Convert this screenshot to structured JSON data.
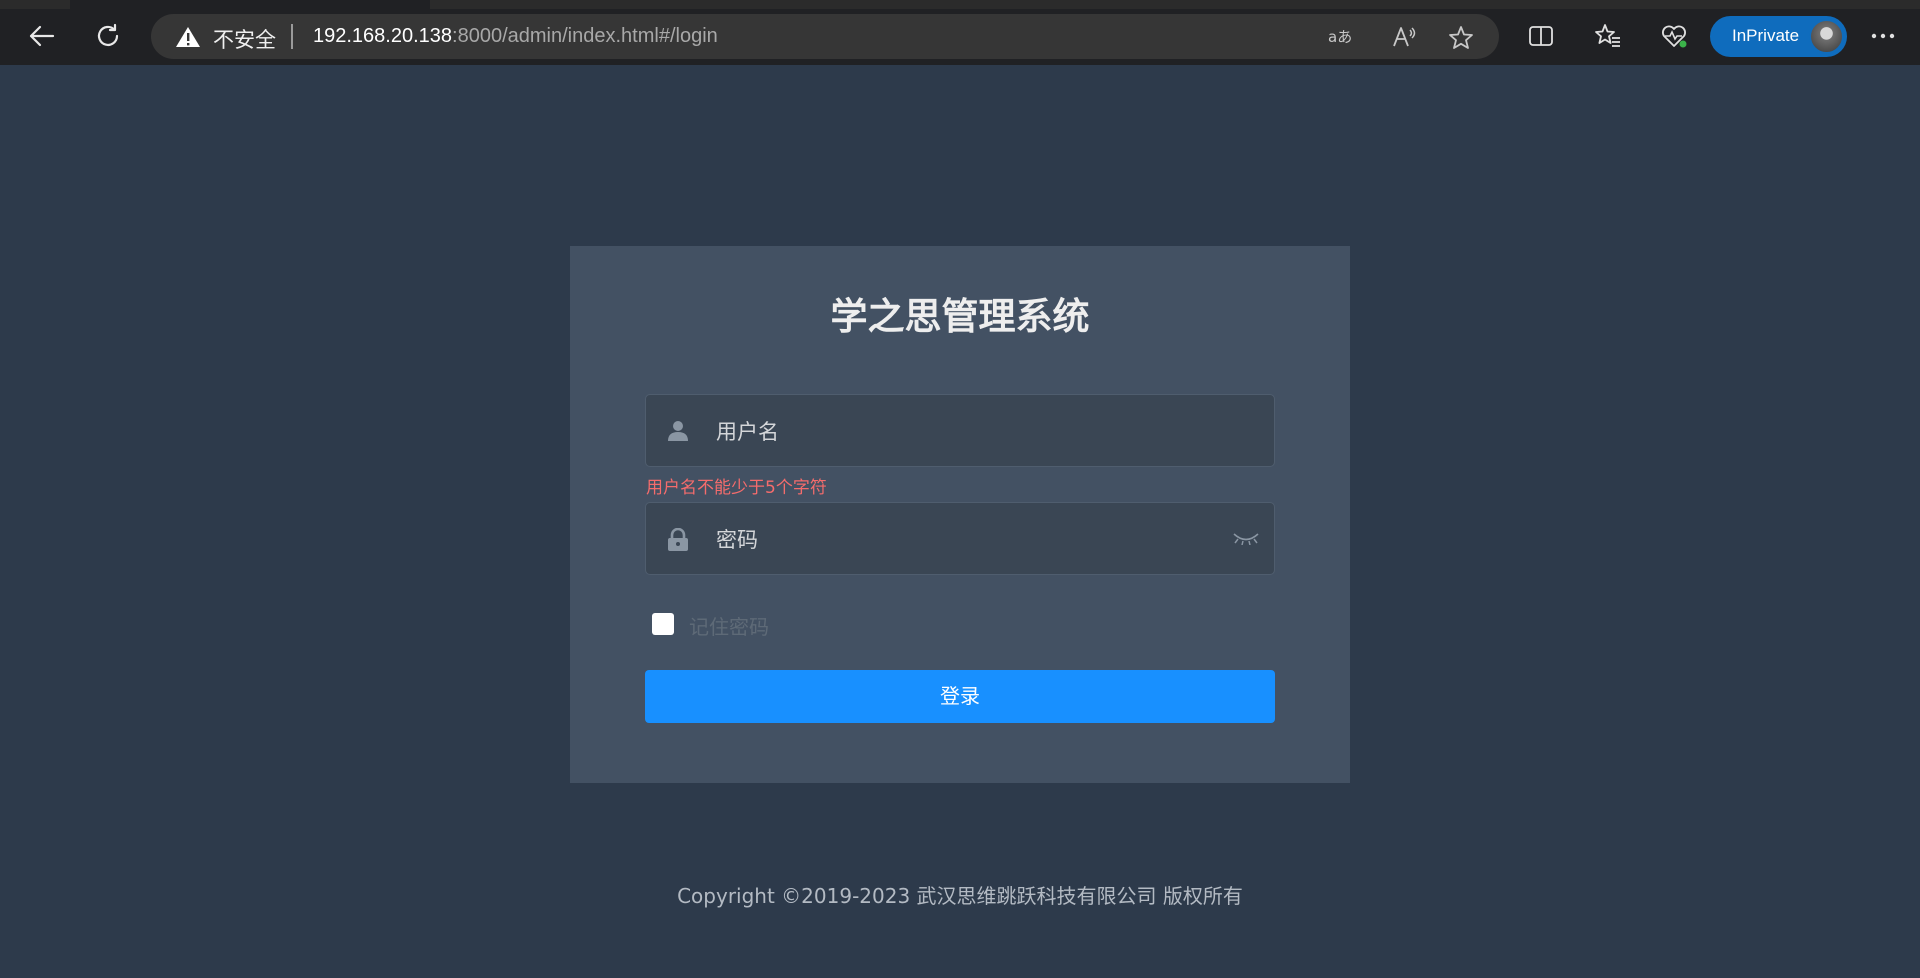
{
  "browser": {
    "security_label": "不安全",
    "url_host": "192.168.20.138",
    "url_rest": ":8000/admin/index.html#/login",
    "inprivate_label": "InPrivate",
    "accent_color": "#0f6cbd"
  },
  "login": {
    "title": "学之思管理系统",
    "username_placeholder": "用户名",
    "username_error": "用户名不能少于5个字符",
    "password_placeholder": "密码",
    "remember_label": "记住密码",
    "remember_checked": false,
    "submit_label": "登录",
    "button_color": "#1890ff",
    "error_color": "#f56c6c"
  },
  "footer": {
    "copyright": "Copyright ©2019-2023 武汉思维跳跃科技有限公司 版权所有"
  }
}
